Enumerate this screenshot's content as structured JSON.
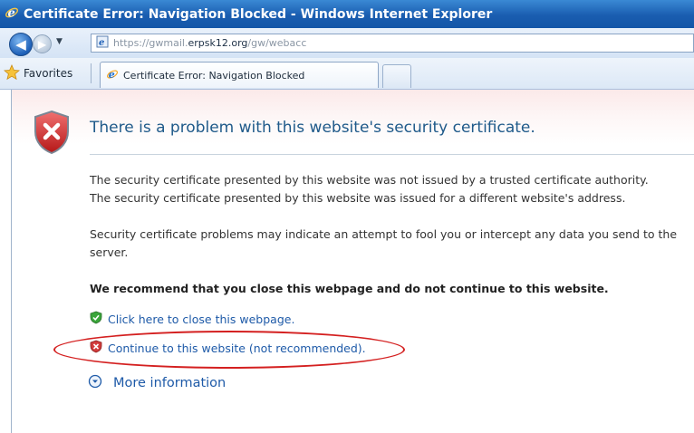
{
  "window": {
    "title": "Certificate Error: Navigation Blocked - Windows Internet Explorer"
  },
  "address": {
    "prefix": "https://gwmail.",
    "domain": "erpsk12.org",
    "suffix": "/gw/webacc"
  },
  "favorites": {
    "label": "Favorites"
  },
  "tab": {
    "title": "Certificate Error: Navigation Blocked"
  },
  "page": {
    "heading": "There is a problem with this website's security certificate.",
    "line1": "The security certificate presented by this website was not issued by a trusted certificate authority.",
    "line2": "The security certificate presented by this website was issued for a different website's address.",
    "line3": "Security certificate problems may indicate an attempt to fool you or intercept any data you send to the",
    "line4": "server.",
    "recommend": "We recommend that you close this webpage and do not continue to this website.",
    "close_link": "Click here to close this webpage.",
    "continue_link": "Continue to this website (not recommended).",
    "more_info": "More information"
  },
  "icons": {
    "shield": "shield-error-icon",
    "close_link": "green-shield-check-icon",
    "continue_link": "red-shield-x-icon",
    "more_info": "expand-circle-icon"
  },
  "colors": {
    "title_bar": "#1a5db0",
    "link": "#1e5aa8",
    "heading": "#1f5a8a",
    "annotation": "#d42020"
  }
}
